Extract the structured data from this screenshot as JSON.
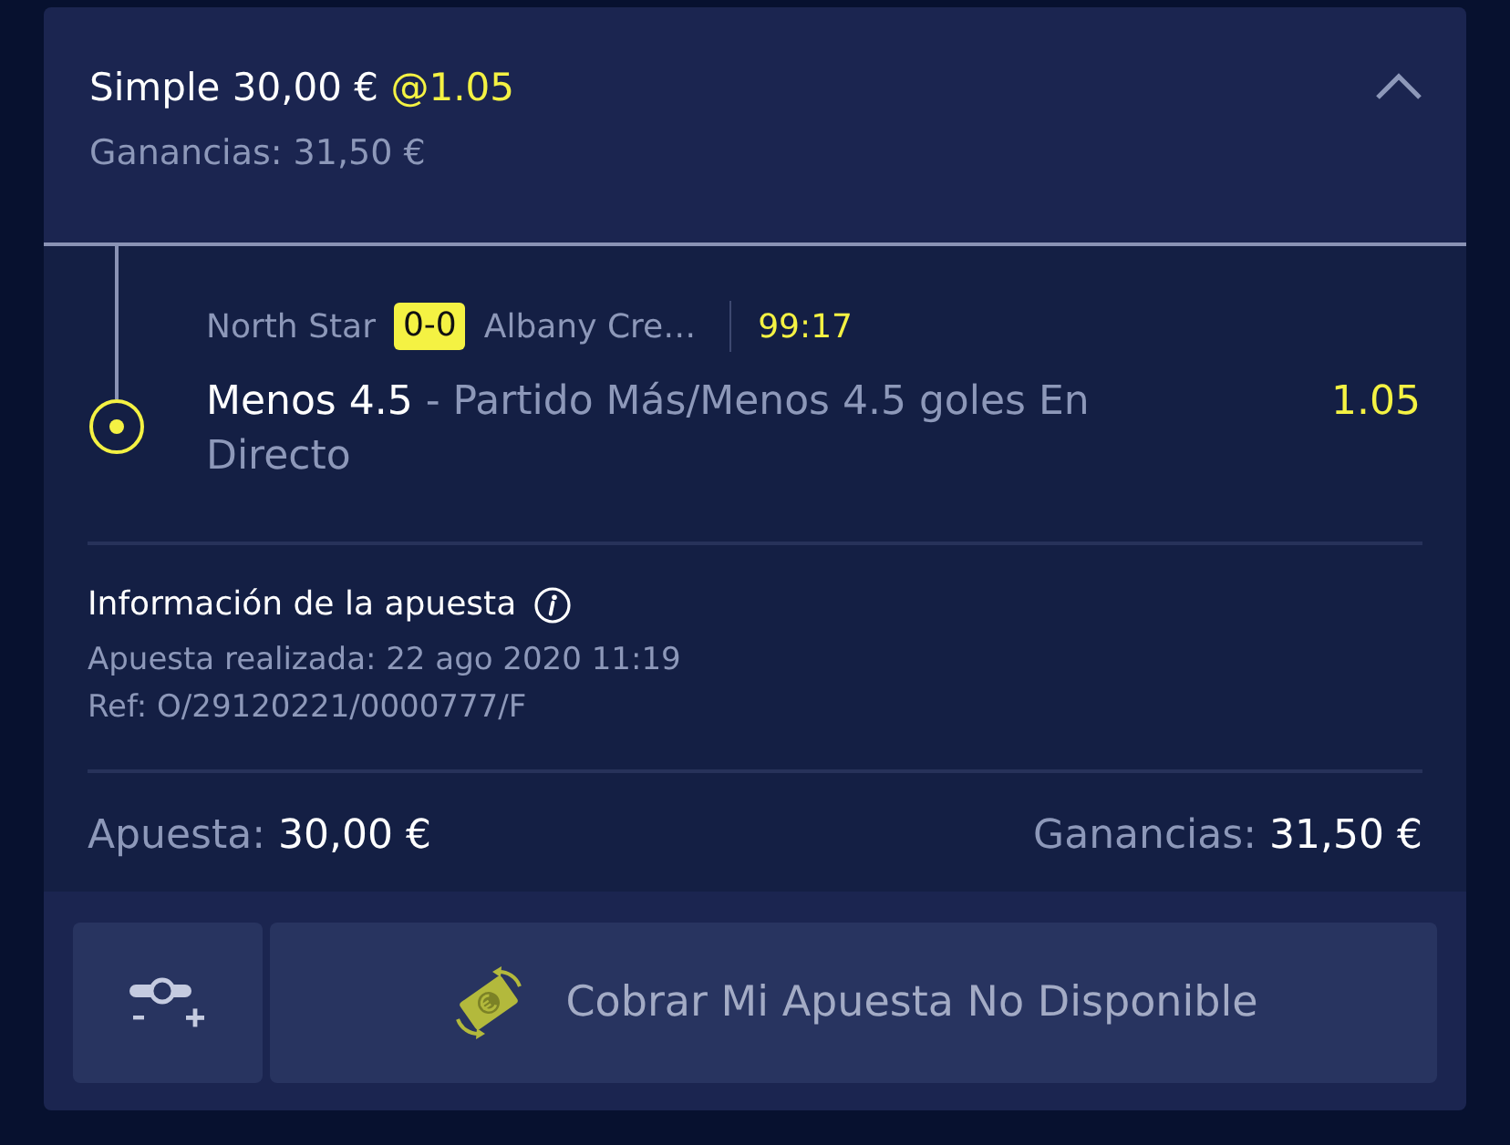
{
  "bet": {
    "title": "Simple 30,00 €",
    "odds": "@1.05",
    "returns_text": "Ganancias: 31,50 €",
    "expanded": true
  },
  "selection": {
    "home": "North Star",
    "score": "0-0",
    "away": "Albany Cre…",
    "clock": "99:17",
    "pick": "Menos 4.5",
    "market": "- Partido Más/Menos 4.5 goles En Directo",
    "odds": "1.05"
  },
  "info": {
    "title": "Información de la apuesta",
    "placed": "Apuesta realizada: 22 ago 2020 11:19",
    "ref": "Ref: O/29120221/0000777/F"
  },
  "totals": {
    "stake_label": "Apuesta:",
    "stake": "30,00 €",
    "returns_label": "Ganancias:",
    "returns": "31,50 €"
  },
  "actions": [
    {
      "kind": "adjust"
    },
    {
      "kind": "cash_out",
      "label": "Cobrar Mi Apuesta No Disponible",
      "disabled": true
    }
  ]
}
